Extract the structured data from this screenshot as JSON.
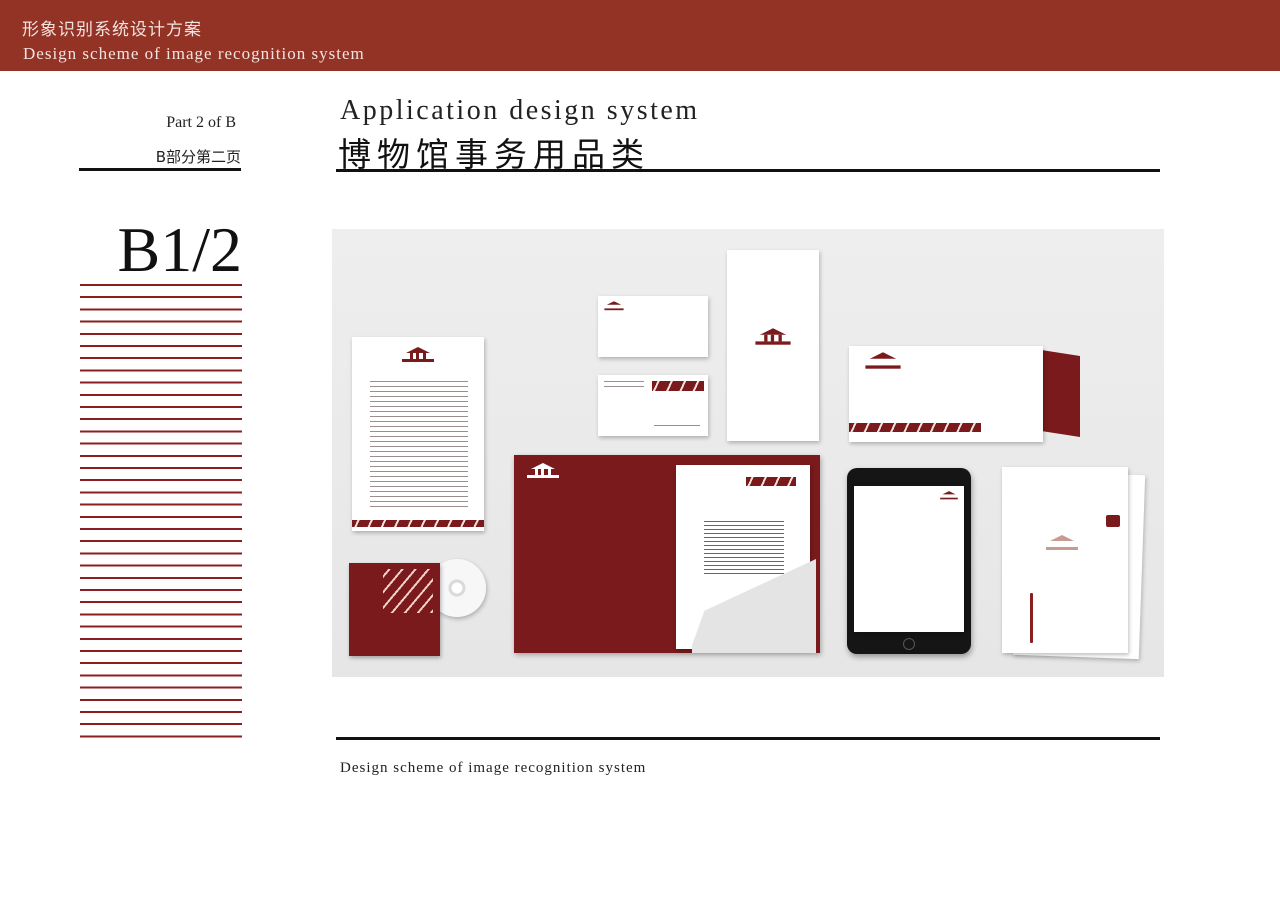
{
  "header": {
    "title_cn": "形象识别系统设计方案",
    "title_en": "Design scheme of image recognition system"
  },
  "sidebar": {
    "part_en": "Part 2 of B",
    "part_cn": "B部分第二页",
    "page_code": "B1/2"
  },
  "section": {
    "title_en": "Application design system",
    "title_cn": "博物馆事务用品类"
  },
  "footer": {
    "text": "Design scheme of image recognition system"
  },
  "colors": {
    "brand_red": "#933326",
    "maroon": "#7a1a1c"
  }
}
